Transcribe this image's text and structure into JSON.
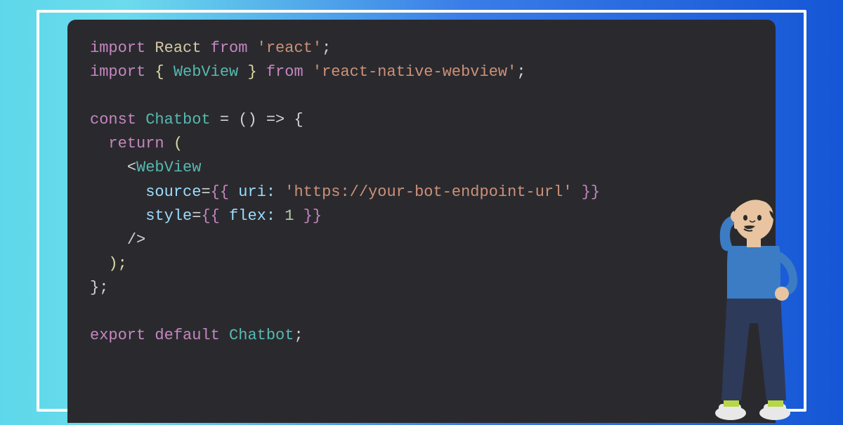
{
  "code": {
    "line1": {
      "kw1": "import",
      "ident1": " React ",
      "kw2": "from",
      "str1": " 'react'",
      "end": ";"
    },
    "line2": {
      "kw1": "import",
      "brace1": " { ",
      "cls1": "WebView",
      "brace2": " } ",
      "kw2": "from",
      "str1": " 'react-native-webview'",
      "end": ";"
    },
    "line3": "",
    "line4": {
      "kw1": "const",
      "cls1": " Chatbot ",
      "op": "= () => {",
      "open": ""
    },
    "line5": {
      "indent": "  ",
      "kw1": "return",
      "paren": " ("
    },
    "line6": {
      "indent": "    ",
      "lt": "<",
      "cls1": "WebView"
    },
    "line7": {
      "indent": "      ",
      "attr1": "source",
      "eq": "=",
      "brace1": "{{ ",
      "key1": "uri:",
      "str1": " 'https://your-bot-endpoint-url'",
      "brace2": " }}"
    },
    "line8": {
      "indent": "      ",
      "attr1": "style",
      "eq": "=",
      "brace1": "{{ ",
      "key1": "flex:",
      "num1": " 1",
      "brace2": " }}"
    },
    "line9": {
      "indent": "    ",
      "close": "/>"
    },
    "line10": {
      "indent": "  ",
      "paren": ");"
    },
    "line11": {
      "brace": "};"
    },
    "line12": "",
    "line13": {
      "kw1": "export",
      "kw2": " default",
      "cls1": " Chatbot",
      "end": ";"
    }
  },
  "illustration": {
    "semantic": "thinking-person",
    "colors": {
      "shirt": "#3b7cc4",
      "pants": "#2e3a5a",
      "skin": "#e8c4a0",
      "hair": "#2a2a2a",
      "shoes": "#e8e8e8",
      "socks": "#b8d648"
    }
  }
}
